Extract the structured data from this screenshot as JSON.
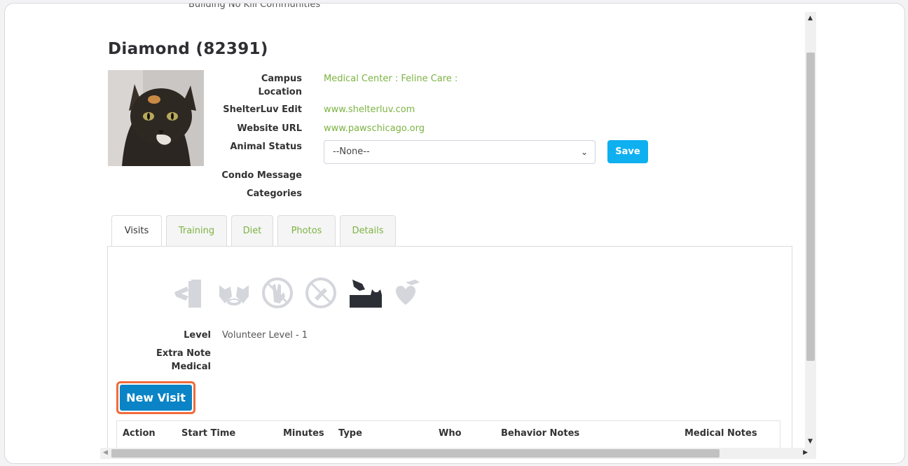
{
  "page": {
    "topline": "Building No Kill Communities",
    "title": "Diamond (82391)"
  },
  "animal": {
    "fields": [
      {
        "label": "Campus Location",
        "value": "Medical Center : Feline Care :"
      },
      {
        "label": "ShelterLuv Edit",
        "value": "www.shelterluv.com"
      },
      {
        "label": "Website URL",
        "value": "www.pawschicago.org"
      },
      {
        "label": "Animal Status",
        "value": ""
      },
      {
        "label": "Condo Message",
        "value": ""
      },
      {
        "label": "Categories",
        "value": ""
      }
    ],
    "status_select": {
      "selected": "--None--"
    },
    "save_label": "Save"
  },
  "tabs": [
    {
      "label": "Visits",
      "active": true
    },
    {
      "label": "Training",
      "active": false
    },
    {
      "label": "Diet",
      "active": false
    },
    {
      "label": "Photos",
      "active": false
    },
    {
      "label": "Details",
      "active": false
    }
  ],
  "visit_icons": [
    "door-exit-icon",
    "cats-food-icon",
    "no-hand-icon",
    "no-treats-icon",
    "hand-petting-cat-icon",
    "heart-hand-icon"
  ],
  "visits": {
    "level_label": "Level",
    "level_value": "Volunteer Level - 1",
    "extra_note_label": "Extra Note",
    "medical_label": "Medical",
    "new_visit_label": "New Visit",
    "table_headers": [
      "Action",
      "Start Time",
      "Minutes",
      "Type",
      "Who",
      "Behavior Notes",
      "Medical Notes"
    ]
  },
  "colors": {
    "link_green": "#7cb342",
    "save_blue": "#0fb0f0",
    "new_visit_blue": "#0a84c6",
    "highlight_orange": "#f26b3a"
  }
}
